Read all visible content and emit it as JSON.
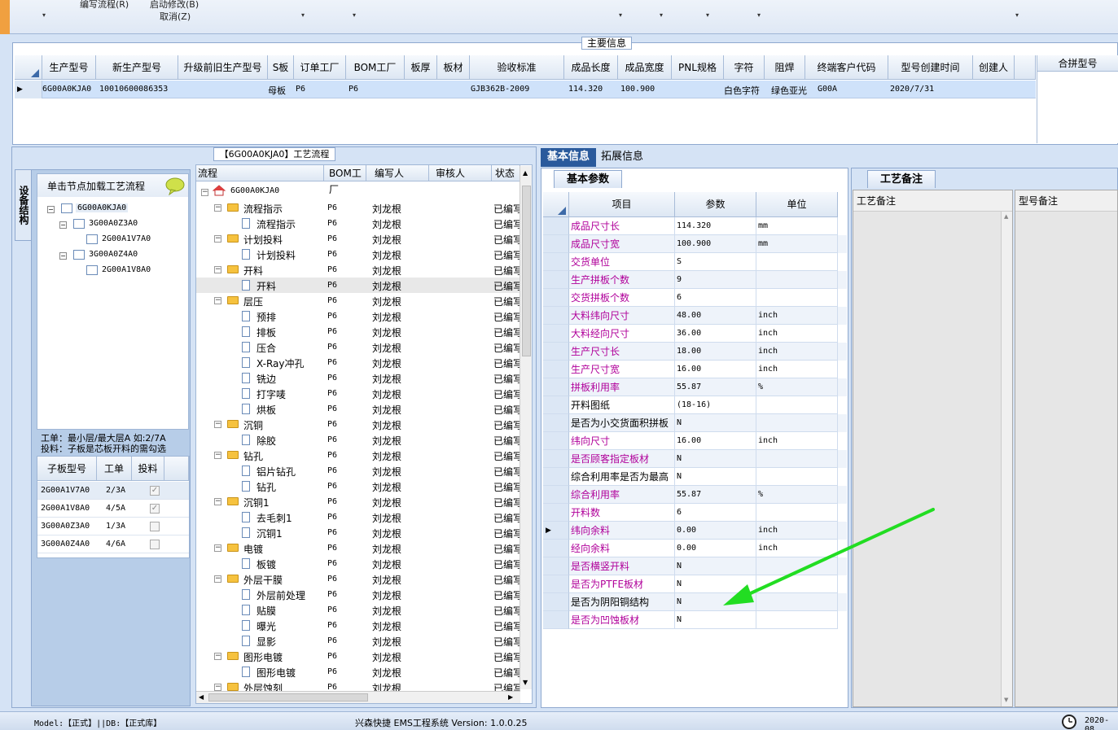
{
  "toolbar": {
    "items": [
      "编写流程(R)",
      "启动修改(B)",
      "取消(Z)"
    ],
    "dropdown_glyph": "▾"
  },
  "main_info": {
    "title": "主要信息",
    "columns": [
      "生产型号",
      "新生产型号",
      "升级前旧生产型号",
      "S板",
      "订单工厂",
      "BOM工厂",
      "板厚",
      "板材",
      "验收标准",
      "成品长度",
      "成品宽度",
      "PNL规格",
      "字符",
      "阻焊",
      "终端客户代码",
      "型号创建时间",
      "创建人"
    ],
    "row": [
      "6G00A0KJA0",
      "10010600086353",
      "",
      "母板",
      "P6",
      "P6",
      "",
      "",
      "GJB362B-2009",
      "114.320",
      "100.900",
      "",
      "白色字符",
      "绿色亚光",
      "G00A",
      "2020/7/31",
      ""
    ],
    "merge_header": "合拼型号"
  },
  "structure": {
    "vertical_tab": "设备结构",
    "hint": "单击节点加载工艺流程",
    "tree": [
      {
        "label": "6G00A0KJA0",
        "level": 0
      },
      {
        "label": "3G00A0Z3A0",
        "level": 1
      },
      {
        "label": "2G00A1V7A0",
        "level": 2
      },
      {
        "label": "3G00A0Z4A0",
        "level": 1
      },
      {
        "label": "2G00A1V8A0",
        "level": 2
      }
    ],
    "note_line1": "工单：最小层/最大层A 如:2/7A",
    "note_line2": "投料：子板是芯板开料的需勾选",
    "child_columns": [
      "子板型号",
      "工单",
      "投料"
    ],
    "child_rows": [
      {
        "model": "2G00A1V7A0",
        "order": "2/3A",
        "checked": true
      },
      {
        "model": "2G00A1V8A0",
        "order": "4/5A",
        "checked": true
      },
      {
        "model": "3G00A0Z3A0",
        "order": "1/3A",
        "checked": false
      },
      {
        "model": "3G00A0Z4A0",
        "order": "4/6A",
        "checked": false
      }
    ]
  },
  "flow": {
    "title": "【6G00A0KJA0】工艺流程",
    "columns": [
      "流程",
      "BOM工厂",
      "编写人",
      "审核人",
      "状态"
    ],
    "root": "6G00A0KJA0",
    "rows": [
      {
        "label": "流程指示",
        "folder": true,
        "bom": "P6",
        "writer": "刘龙根",
        "status": "已编写"
      },
      {
        "label": "流程指示",
        "folder": false,
        "bom": "P6",
        "writer": "刘龙根",
        "status": "已编写"
      },
      {
        "label": "计划投料",
        "folder": true,
        "bom": "P6",
        "writer": "刘龙根",
        "status": "已编写"
      },
      {
        "label": "计划投料",
        "folder": false,
        "bom": "P6",
        "writer": "刘龙根",
        "status": "已编写"
      },
      {
        "label": "开料",
        "folder": true,
        "bom": "P6",
        "writer": "刘龙根",
        "status": "已编写"
      },
      {
        "label": "开料",
        "folder": false,
        "bom": "P6",
        "writer": "刘龙根",
        "status": "已编写",
        "selected": true
      },
      {
        "label": "层压",
        "folder": true,
        "bom": "P6",
        "writer": "刘龙根",
        "status": "已编写"
      },
      {
        "label": "预排",
        "folder": false,
        "bom": "P6",
        "writer": "刘龙根",
        "status": "已编写"
      },
      {
        "label": "排板",
        "folder": false,
        "bom": "P6",
        "writer": "刘龙根",
        "status": "已编写"
      },
      {
        "label": "压合",
        "folder": false,
        "bom": "P6",
        "writer": "刘龙根",
        "status": "已编写"
      },
      {
        "label": "X-Ray冲孔",
        "folder": false,
        "bom": "P6",
        "writer": "刘龙根",
        "status": "已编写"
      },
      {
        "label": "铣边",
        "folder": false,
        "bom": "P6",
        "writer": "刘龙根",
        "status": "已编写"
      },
      {
        "label": "打字唛",
        "folder": false,
        "bom": "P6",
        "writer": "刘龙根",
        "status": "已编写"
      },
      {
        "label": "烘板",
        "folder": false,
        "bom": "P6",
        "writer": "刘龙根",
        "status": "已编写"
      },
      {
        "label": "沉铜",
        "folder": true,
        "bom": "P6",
        "writer": "刘龙根",
        "status": "已编写"
      },
      {
        "label": "除胶",
        "folder": false,
        "bom": "P6",
        "writer": "刘龙根",
        "status": "已编写"
      },
      {
        "label": "钻孔",
        "folder": true,
        "bom": "P6",
        "writer": "刘龙根",
        "status": "已编写"
      },
      {
        "label": "铝片钻孔",
        "folder": false,
        "bom": "P6",
        "writer": "刘龙根",
        "status": "已编写"
      },
      {
        "label": "钻孔",
        "folder": false,
        "bom": "P6",
        "writer": "刘龙根",
        "status": "已编写"
      },
      {
        "label": "沉铜1",
        "folder": true,
        "bom": "P6",
        "writer": "刘龙根",
        "status": "已编写"
      },
      {
        "label": "去毛刺1",
        "folder": false,
        "bom": "P6",
        "writer": "刘龙根",
        "status": "已编写"
      },
      {
        "label": "沉铜1",
        "folder": false,
        "bom": "P6",
        "writer": "刘龙根",
        "status": "已编写"
      },
      {
        "label": "电镀",
        "folder": true,
        "bom": "P6",
        "writer": "刘龙根",
        "status": "已编写"
      },
      {
        "label": "板镀",
        "folder": false,
        "bom": "P6",
        "writer": "刘龙根",
        "status": "已编写"
      },
      {
        "label": "外层干膜",
        "folder": true,
        "bom": "P6",
        "writer": "刘龙根",
        "status": "已编写"
      },
      {
        "label": "外层前处理",
        "folder": false,
        "bom": "P6",
        "writer": "刘龙根",
        "status": "已编写"
      },
      {
        "label": "贴膜",
        "folder": false,
        "bom": "P6",
        "writer": "刘龙根",
        "status": "已编写"
      },
      {
        "label": "曝光",
        "folder": false,
        "bom": "P6",
        "writer": "刘龙根",
        "status": "已编写"
      },
      {
        "label": "显影",
        "folder": false,
        "bom": "P6",
        "writer": "刘龙根",
        "status": "已编写"
      },
      {
        "label": "图形电镀",
        "folder": true,
        "bom": "P6",
        "writer": "刘龙根",
        "status": "已编写"
      },
      {
        "label": "图形电镀",
        "folder": false,
        "bom": "P6",
        "writer": "刘龙根",
        "status": "已编写"
      },
      {
        "label": "外层蚀刻",
        "folder": true,
        "bom": "P6",
        "writer": "刘龙根",
        "status": "已编写"
      }
    ]
  },
  "right_tabs": {
    "active": "基本信息",
    "other": "拓展信息"
  },
  "basic_params": {
    "title": "基本参数",
    "columns": [
      "项目",
      "参数",
      "单位"
    ],
    "rows": [
      {
        "item": "成品尺寸长",
        "value": "114.320",
        "unit": "mm",
        "color": "#b0009a"
      },
      {
        "item": "成品尺寸宽",
        "value": "100.900",
        "unit": "mm",
        "color": "#b0009a"
      },
      {
        "item": "交货单位",
        "value": "S",
        "unit": "",
        "color": "#b0009a"
      },
      {
        "item": "生产拼板个数",
        "value": "9",
        "unit": "",
        "color": "#b0009a"
      },
      {
        "item": "交货拼板个数",
        "value": "6",
        "unit": "",
        "color": "#b0009a"
      },
      {
        "item": "大料纬向尺寸",
        "value": "48.00",
        "unit": "inch",
        "color": "#b0009a"
      },
      {
        "item": "大料经向尺寸",
        "value": "36.00",
        "unit": "inch",
        "color": "#b0009a"
      },
      {
        "item": "生产尺寸长",
        "value": "18.00",
        "unit": "inch",
        "color": "#b0009a"
      },
      {
        "item": "生产尺寸宽",
        "value": "16.00",
        "unit": "inch",
        "color": "#b0009a"
      },
      {
        "item": "拼板利用率",
        "value": "55.87",
        "unit": "%",
        "color": "#b0009a"
      },
      {
        "item": "开料图纸",
        "value": "(18-16)",
        "unit": "",
        "color": "#000000"
      },
      {
        "item": "是否为小交货面积拼板",
        "value": "N",
        "unit": "",
        "color": "#000000"
      },
      {
        "item": "纬向尺寸",
        "value": "16.00",
        "unit": "inch",
        "color": "#b0009a"
      },
      {
        "item": "是否顾客指定板材",
        "value": "N",
        "unit": "",
        "color": "#b0009a"
      },
      {
        "item": "综合利用率是否为最高",
        "value": "N",
        "unit": "",
        "color": "#000000"
      },
      {
        "item": "综合利用率",
        "value": "55.87",
        "unit": "%",
        "color": "#b0009a"
      },
      {
        "item": "开料数",
        "value": "6",
        "unit": "",
        "color": "#b0009a"
      },
      {
        "item": "纬向余料",
        "value": "0.00",
        "unit": "inch",
        "color": "#b0009a",
        "current": true
      },
      {
        "item": "经向余料",
        "value": "0.00",
        "unit": "inch",
        "color": "#b0009a"
      },
      {
        "item": "是否横竖开料",
        "value": "N",
        "unit": "",
        "color": "#b0009a"
      },
      {
        "item": "是否为PTFE板材",
        "value": "N",
        "unit": "",
        "color": "#b0009a"
      },
      {
        "item": "是否为阴阳铜结构",
        "value": "N",
        "unit": "",
        "color": "#000000"
      },
      {
        "item": "是否为凹蚀板材",
        "value": "N",
        "unit": "",
        "color": "#b0009a"
      }
    ]
  },
  "craft_notes": {
    "title": "工艺备注",
    "col_a": "工艺备注",
    "col_b": "型号备注"
  },
  "status": {
    "model_db": "Model:【正式】||DB:【正式库】",
    "app_name": "兴森快捷 EMS工程系统 Version: 1.0.0.25",
    "date": "2020-08"
  },
  "annotation_color": "#22dd22"
}
